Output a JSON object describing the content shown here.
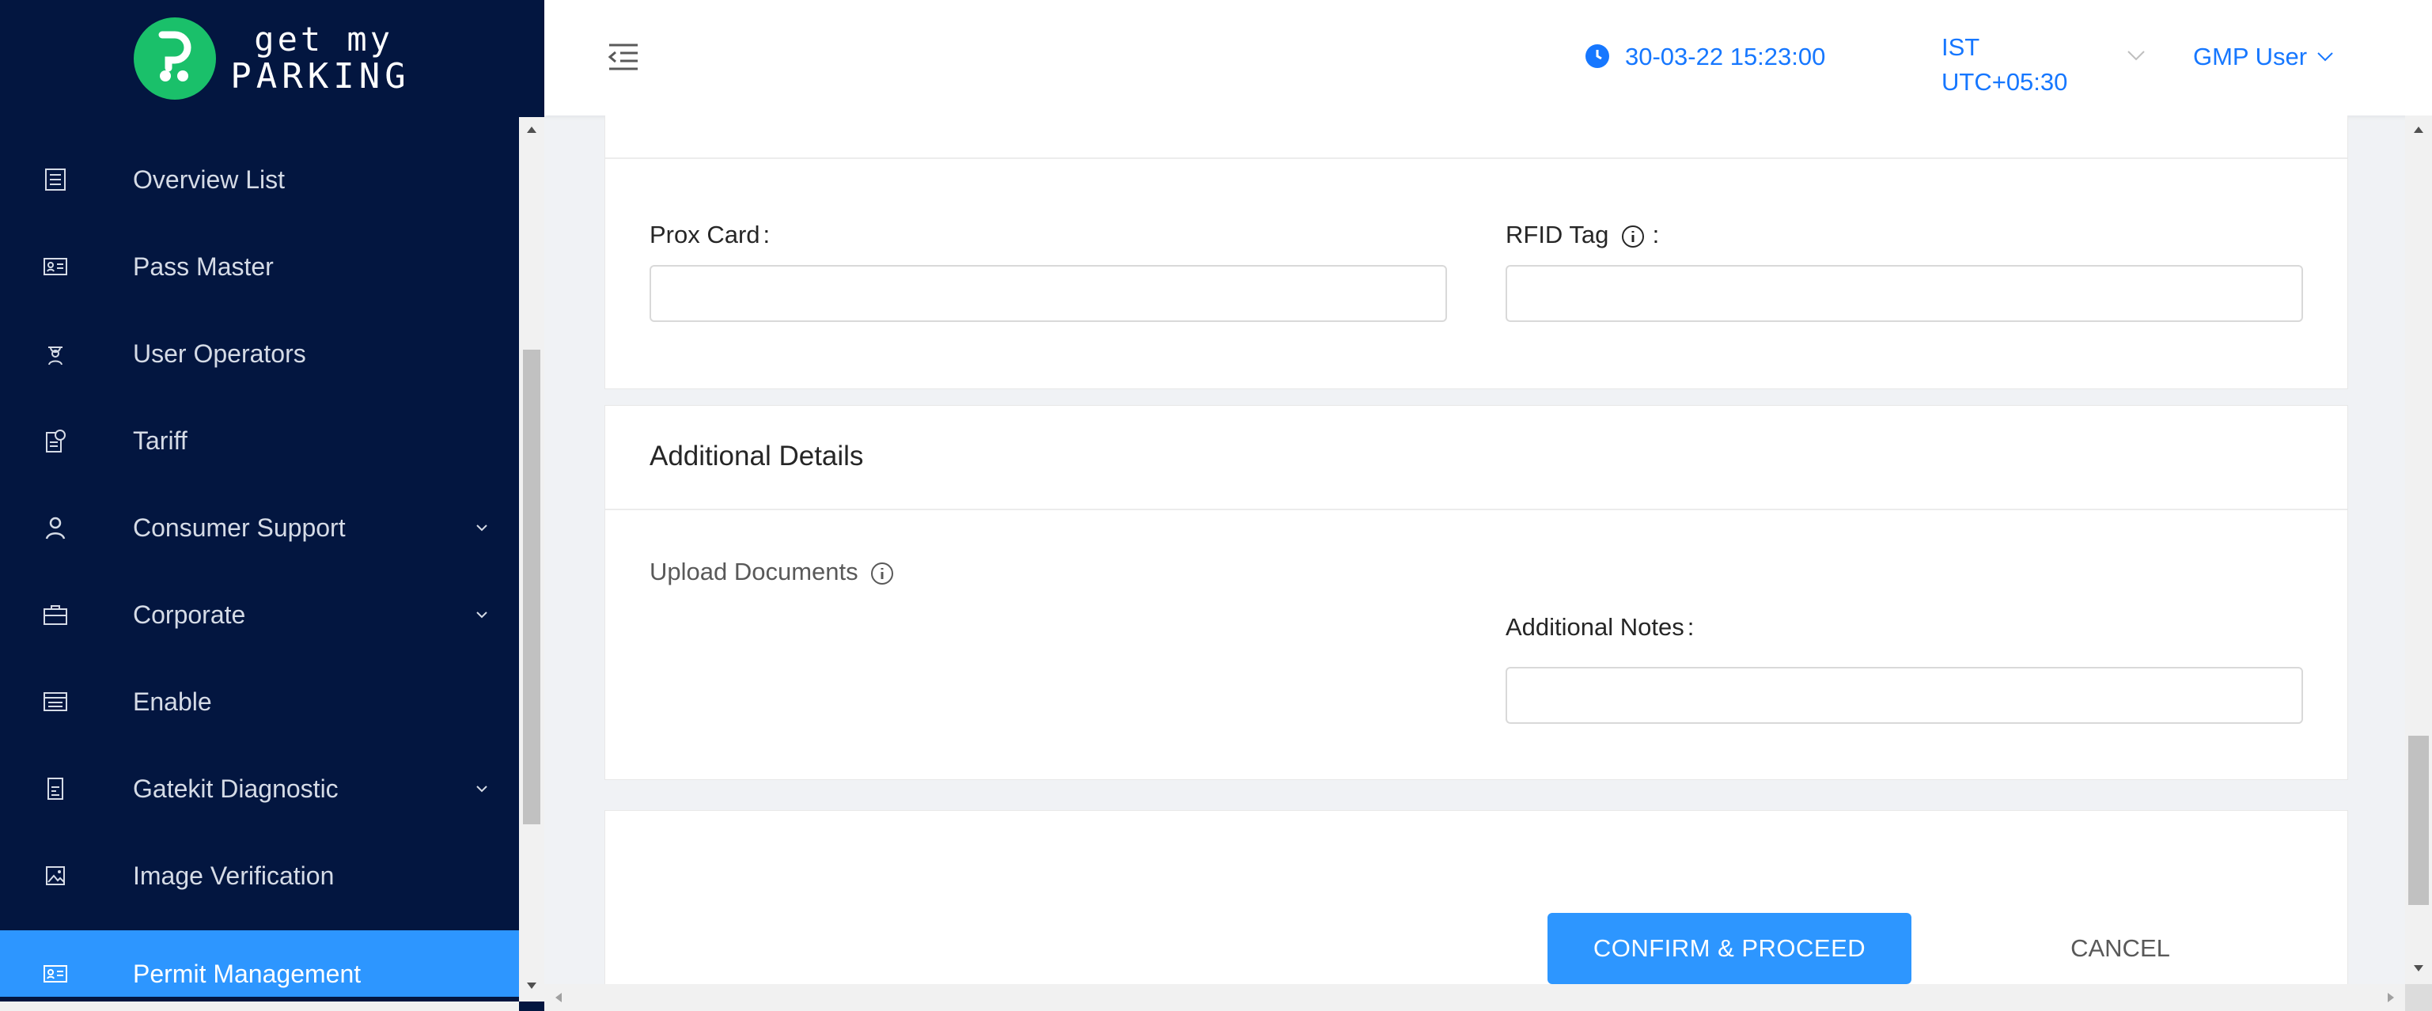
{
  "brand": {
    "line1": "get my",
    "line2": "PARKING",
    "accent_color": "#1ac06a"
  },
  "sidebar": {
    "background": "#031640",
    "items": [
      {
        "label": "Overview List",
        "icon": "list-icon",
        "has_submenu": false
      },
      {
        "label": "Pass Master",
        "icon": "id-card-icon",
        "has_submenu": false
      },
      {
        "label": "User Operators",
        "icon": "operator-icon",
        "has_submenu": false
      },
      {
        "label": "Tariff",
        "icon": "tariff-icon",
        "has_submenu": false
      },
      {
        "label": "Consumer Support",
        "icon": "user-icon",
        "has_submenu": true
      },
      {
        "label": "Corporate",
        "icon": "briefcase-icon",
        "has_submenu": true
      },
      {
        "label": "Enable",
        "icon": "enable-icon",
        "has_submenu": false
      },
      {
        "label": "Gatekit Diagnostic",
        "icon": "diagnostic-icon",
        "has_submenu": true
      },
      {
        "label": "Image Verification",
        "icon": "image-icon",
        "has_submenu": false
      },
      {
        "label": "Permit Management",
        "icon": "permit-icon",
        "has_submenu": false,
        "active": true
      }
    ]
  },
  "header": {
    "datetime": "30-03-22 15:23:00",
    "timezone_line1": "IST",
    "timezone_line2": "UTC+05:30",
    "user_name": "GMP User",
    "accent_color": "#1677ff"
  },
  "form": {
    "prox_card": {
      "label": "Prox Card",
      "value": "",
      "placeholder": ""
    },
    "rfid_tag": {
      "label": "RFID Tag",
      "value": "",
      "placeholder": ""
    },
    "additional_details": {
      "title": "Additional Details",
      "upload_label": "Upload Documents",
      "notes": {
        "label": "Additional Notes",
        "value": "",
        "placeholder": ""
      }
    },
    "label_suffix": ":",
    "actions": {
      "confirm": "CONFIRM & PROCEED",
      "cancel": "CANCEL"
    }
  }
}
